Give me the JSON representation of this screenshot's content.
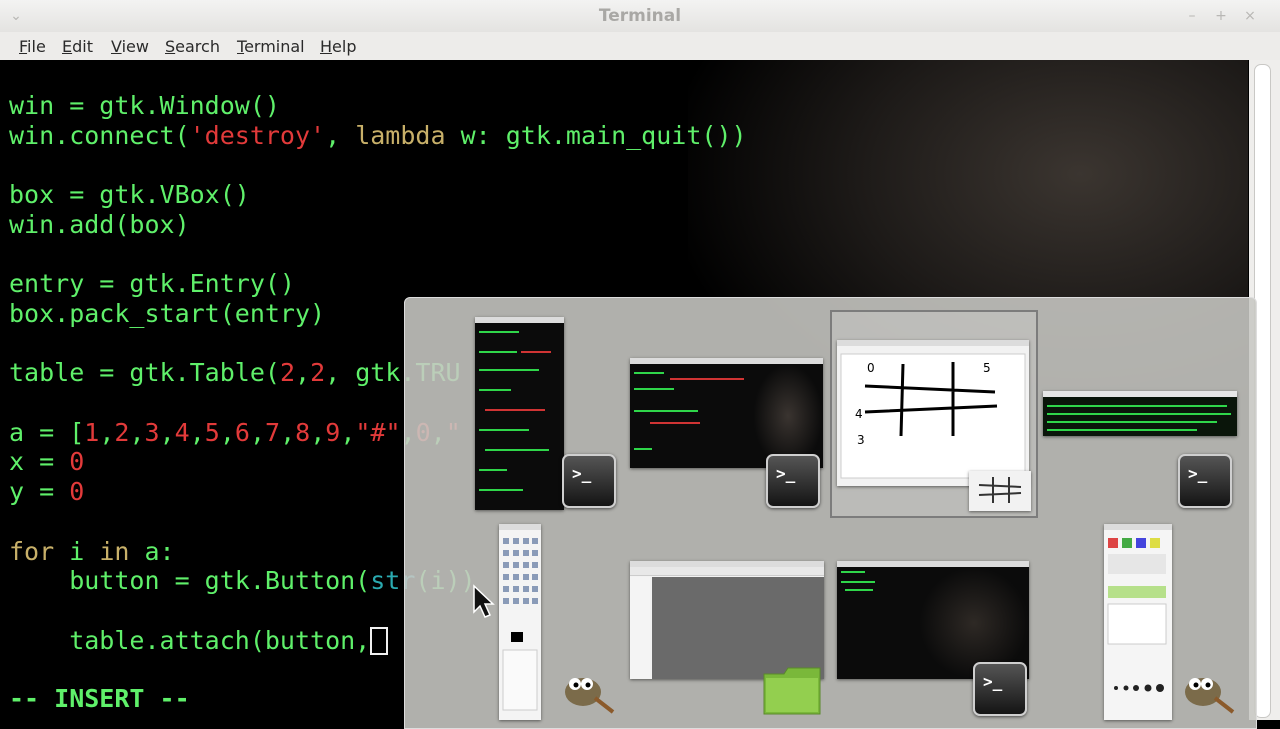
{
  "window": {
    "title": "Terminal",
    "controls": {
      "minimize": "–",
      "maximize": "+",
      "close": "×"
    }
  },
  "menu": [
    {
      "label": "File",
      "mnemonic": "F",
      "rest": "ile"
    },
    {
      "label": "Edit",
      "mnemonic": "E",
      "rest": "dit"
    },
    {
      "label": "View",
      "mnemonic": "V",
      "rest": "iew"
    },
    {
      "label": "Search",
      "mnemonic": "S",
      "rest": "earch"
    },
    {
      "label": "Terminal",
      "mnemonic": "T",
      "rest": "erminal"
    },
    {
      "label": "Help",
      "mnemonic": "H",
      "rest": "elp"
    }
  ],
  "editor": {
    "lines": [
      "win = gtk.Window()",
      "win.connect('destroy', lambda w: gtk.main_quit())",
      "",
      "box = gtk.VBox()",
      "win.add(box)",
      "",
      "entry = gtk.Entry()",
      "box.pack_start(entry)",
      "",
      "table = gtk.Table(2,2, gtk.TRU",
      "",
      "a = [1,2,3,4,5,6,7,8,9,\"#\",0,\"",
      "x = 0",
      "y = 0",
      "",
      "for i in a:",
      "    button = gtk.Button(str(i))",
      "",
      "    table.attach(button,"
    ],
    "mode": "-- INSERT --"
  },
  "switcher": {
    "windows": [
      {
        "name": "terminal-window-1",
        "app": "Terminal"
      },
      {
        "name": "terminal-window-2",
        "app": "Terminal"
      },
      {
        "name": "gimp-image-window",
        "app": "GIMP",
        "selected": true
      },
      {
        "name": "terminal-window-3",
        "app": "Terminal"
      },
      {
        "name": "gimp-toolbox",
        "app": "GIMP"
      },
      {
        "name": "file-manager-window",
        "app": "Files"
      },
      {
        "name": "terminal-window-4",
        "app": "Terminal"
      },
      {
        "name": "gimp-layers-dock",
        "app": "GIMP"
      }
    ],
    "icons": [
      "terminal-icon",
      "gimp-icon",
      "folder-icon"
    ]
  },
  "colors": {
    "code_green": "#5ff06a",
    "string_red": "#e23a3a",
    "titlebar_bg": "#edecea"
  }
}
